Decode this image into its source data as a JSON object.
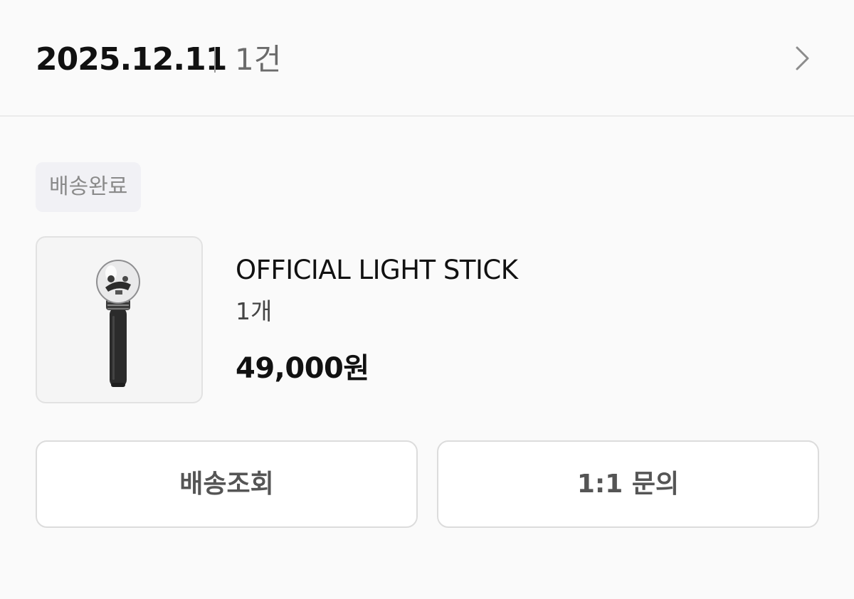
{
  "order": {
    "date": "2025.12.11",
    "count": "1건"
  },
  "icons": {
    "chevron": "chevron-right-icon",
    "product_image": "light-stick-image"
  },
  "status_badge": "배송완료",
  "product": {
    "name": "OFFICIAL LIGHT STICK",
    "quantity": "1개",
    "price": "49,000원"
  },
  "buttons": {
    "tracking_label": "배송조회",
    "inquiry_label": "1:1 문의"
  },
  "colors": {
    "background": "#fafafa",
    "badge_bg": "#f1f1f5",
    "badge_text": "#8a8a8a",
    "button_text": "#555555",
    "border": "#dcdcdc"
  }
}
